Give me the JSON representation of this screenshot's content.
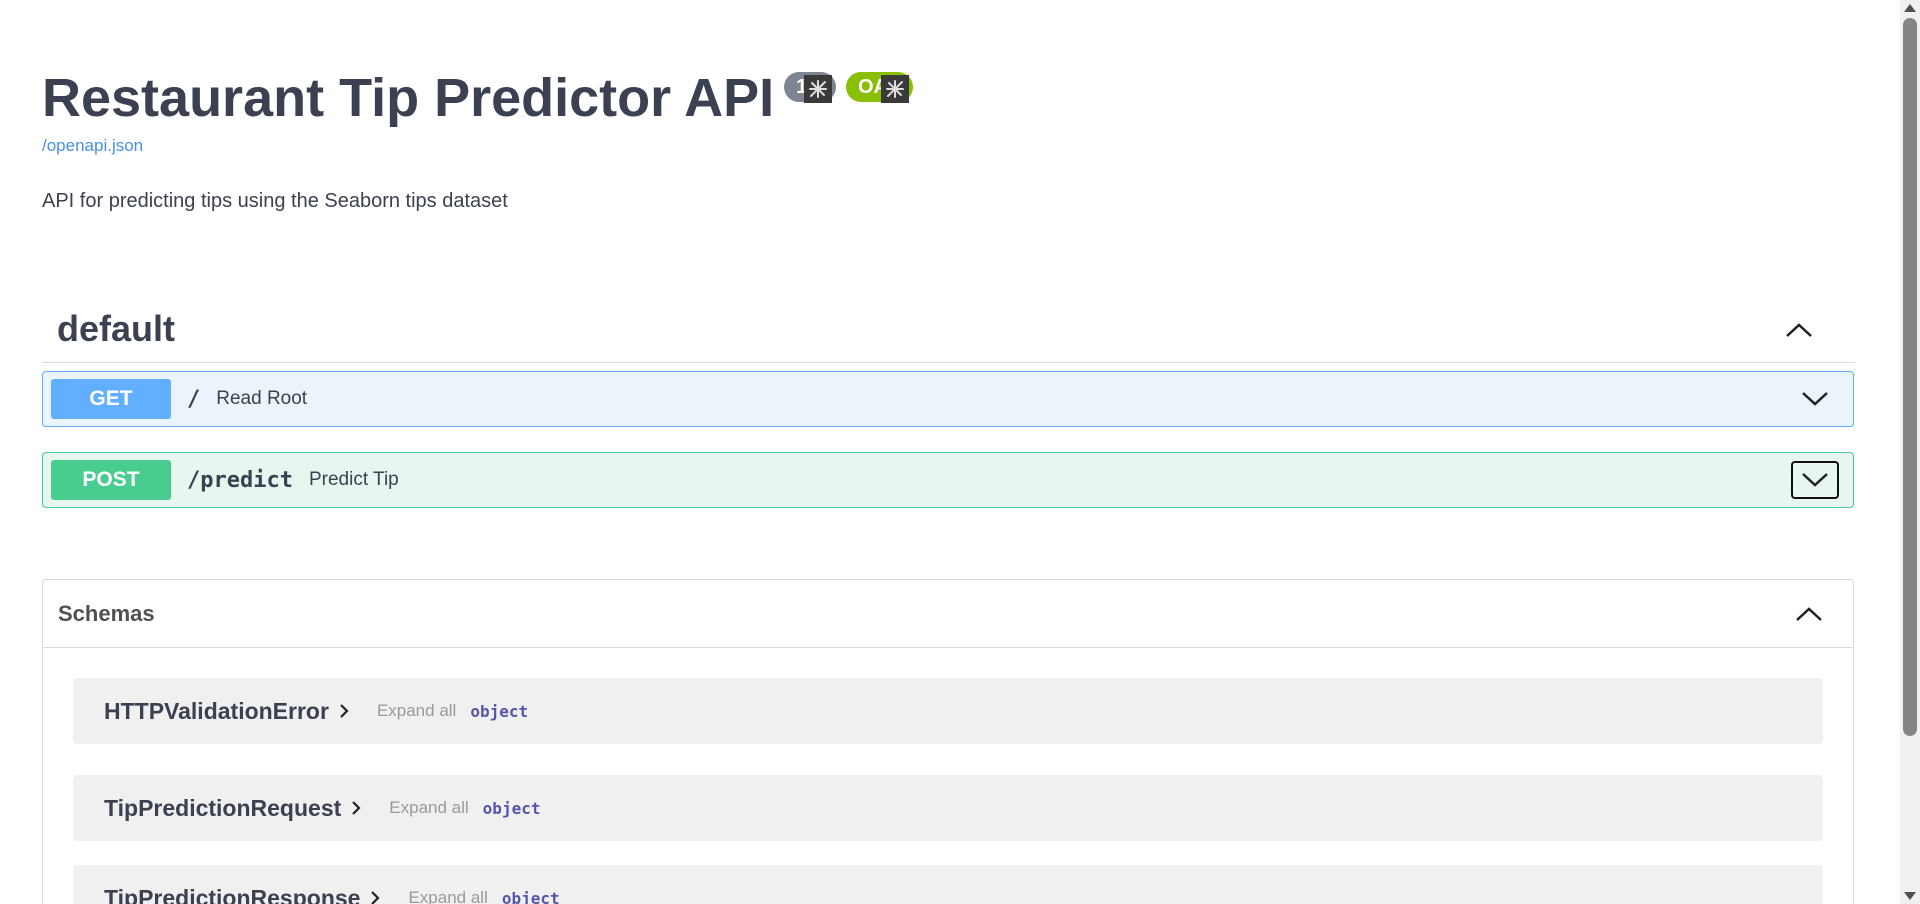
{
  "header": {
    "title": "Restaurant Tip Predictor API",
    "version_badge": "1.0",
    "oas_badge": "OAS",
    "openapi_link": "/openapi.json",
    "description": "API for predicting tips using the Seaborn tips dataset"
  },
  "tag": {
    "name": "default",
    "operations": [
      {
        "method": "GET",
        "path": "/",
        "summary": "Read Root"
      },
      {
        "method": "POST",
        "path": "/predict",
        "summary": "Predict Tip"
      }
    ]
  },
  "schemas": {
    "title": "Schemas",
    "models": [
      {
        "name": "HTTPValidationError",
        "expand_label": "Expand all",
        "type": "object"
      },
      {
        "name": "TipPredictionRequest",
        "expand_label": "Expand all",
        "type": "object"
      },
      {
        "name": "TipPredictionResponse",
        "expand_label": "Expand all",
        "type": "object"
      }
    ]
  },
  "colors": {
    "get": "#61affe",
    "post": "#49cc90",
    "oas_badge": "#89bf04",
    "version_badge": "#7d8492",
    "link": "#4990e2"
  },
  "icons": [
    "chevron-up-icon",
    "chevron-down-icon",
    "chevron-right-icon"
  ]
}
